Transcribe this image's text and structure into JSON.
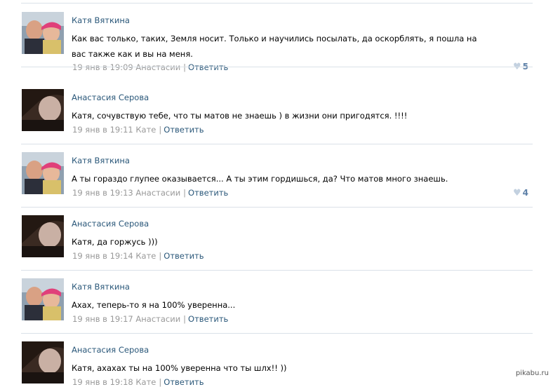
{
  "colors": {
    "link": "#2b587a",
    "meta": "#999999",
    "likes": "#5e81a8",
    "separator": "#dae1e8"
  },
  "comments": [
    {
      "author": "Катя Вяткина",
      "avatar": "avatar-katya",
      "text": "Как вас только, таких, Земля носит. Только и научились посылать, да оскорблять, я пошла на вас также как и вы на меня.",
      "time": "19 янв в 19:09",
      "reply_to": "Анастасии",
      "reply_label": "Ответить",
      "likes": "5"
    },
    {
      "author": "Анастасия Серова",
      "avatar": "avatar-anastasia",
      "text": "Катя, сочувствую тебе, что ты матов не знаешь ) в жизни они пригодятся. !!!!",
      "time": "19 янв в 19:11",
      "reply_to": "Кате",
      "reply_label": "Ответить",
      "likes": ""
    },
    {
      "author": "Катя Вяткина",
      "avatar": "avatar-katya",
      "text": "А ты гораздо глупее оказывается... А ты этим гордишься, да? Что матов много знаешь.",
      "time": "19 янв в 19:13",
      "reply_to": "Анастасии",
      "reply_label": "Ответить",
      "likes": "4"
    },
    {
      "author": "Анастасия Серова",
      "avatar": "avatar-anastasia",
      "text": "Катя, да горжусь )))",
      "time": "19 янв в 19:14",
      "reply_to": "Кате",
      "reply_label": "Ответить",
      "likes": ""
    },
    {
      "author": "Катя Вяткина",
      "avatar": "avatar-katya",
      "text": "Ахах, теперь-то я на 100% уверенна...",
      "time": "19 янв в 19:17",
      "reply_to": "Анастасии",
      "reply_label": "Ответить",
      "likes": ""
    },
    {
      "author": "Анастасия Серова",
      "avatar": "avatar-anastasia",
      "text": "Катя, ахахах ты на 100% уверенна что ты шлх!! ))",
      "time": "19 янв в 19:18",
      "reply_to": "Кате",
      "reply_label": "Ответить",
      "likes": ""
    }
  ],
  "watermark": "pikabu.ru"
}
